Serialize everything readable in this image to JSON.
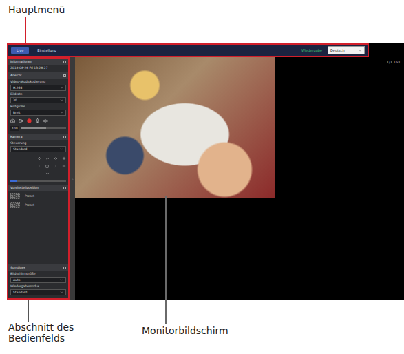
{
  "labels": {
    "main_menu": "Hauptmenü",
    "panel_section": "Abschnitt des Bedienfelds",
    "monitor": "Monitorbildschirm"
  },
  "menu": {
    "tabs": [
      {
        "label": "Live",
        "selected": true
      },
      {
        "label": "Einstellung",
        "selected": false
      }
    ],
    "link": "Wiedergabe",
    "language": "Deutsch"
  },
  "corner_text": "1/1 160",
  "panel": {
    "info": {
      "title": "Informationen",
      "datetime": "2018-08-26 Fri 13:28:27"
    },
    "view": {
      "title": "Ansicht",
      "fields": [
        {
          "label": "Video-/Audiokodierung",
          "value": "H.264"
        },
        {
          "label": "Bildrate",
          "value": "30"
        },
        {
          "label": "Bildgröße",
          "value": "Breit"
        }
      ],
      "volume": {
        "reading": "100",
        "level": 0.55
      }
    },
    "camera": {
      "title": "Kamera",
      "fields": [
        {
          "label": "Steuerung",
          "value": "Standard"
        }
      ],
      "zoom": {
        "level": 0.12
      }
    },
    "presets": {
      "title": "Voreinstellposition",
      "items": [
        "Preset",
        "Preset"
      ]
    },
    "other": {
      "title": "Sonstiges",
      "fields": [
        {
          "label": "Bildschirmgröße",
          "value": "Auto"
        },
        {
          "label": "Wiedergabemodus",
          "value": "Standard"
        }
      ]
    }
  }
}
